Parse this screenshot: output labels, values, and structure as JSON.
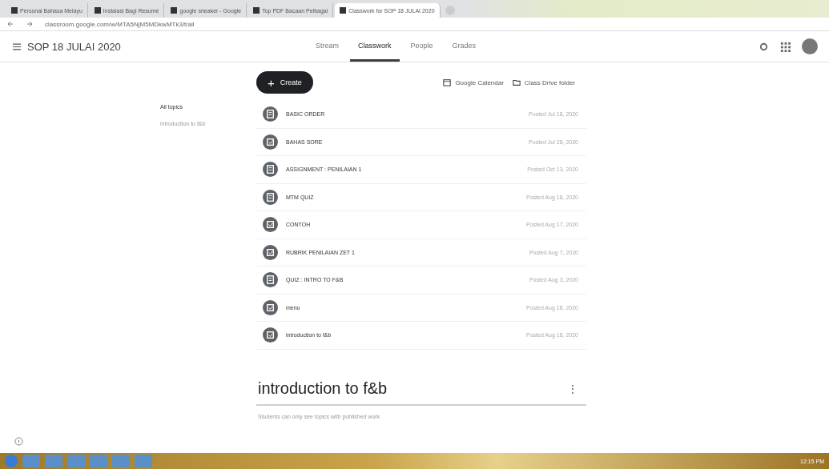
{
  "browser": {
    "tabs": [
      {
        "title": "Personal Bahasa Melayu",
        "selected": false
      },
      {
        "title": "Instalasi Bagi Resume",
        "selected": false
      },
      {
        "title": "google sneaker - Google",
        "selected": false
      },
      {
        "title": "Top PDF Bacaan Pelbagai",
        "selected": false
      },
      {
        "title": "Classwork for SOP 18 JULAI 2020",
        "selected": true
      }
    ],
    "url": "classroom.google.com/w/MTA5NjM5MDkwMTk3/t/all"
  },
  "header": {
    "title": "SOP 18 JULAI 2020",
    "tabs": [
      {
        "label": "Stream",
        "selected": false
      },
      {
        "label": "Classwork",
        "selected": true
      },
      {
        "label": "People",
        "selected": false
      },
      {
        "label": "Grades",
        "selected": false
      }
    ]
  },
  "toolbar": {
    "create_icon": "+",
    "create": "Create",
    "links": [
      "Google Calendar",
      "Class Drive folder"
    ]
  },
  "topics": [
    {
      "label": "All topics",
      "selected": true
    },
    {
      "label": "introduction to f&b",
      "selected": false
    }
  ],
  "items": [
    {
      "kind": "assignment",
      "title": "BASIC ORDER",
      "date": "Posted Jul 18, 2020"
    },
    {
      "kind": "quiz",
      "title": "BAHAS SORE",
      "date": "Posted Jul 28, 2020"
    },
    {
      "kind": "assignment",
      "title": "ASSIGNMENT : PENILAIAN 1",
      "date": "Posted Oct 13, 2020"
    },
    {
      "kind": "assignment",
      "title": "MTM QUIZ",
      "date": "Posted Aug 18, 2020"
    },
    {
      "kind": "quiz",
      "title": "CONTOH",
      "date": "Posted Aug 17, 2020"
    },
    {
      "kind": "quiz",
      "title": "RUBRIK PENILAIAN ZET 1",
      "date": "Posted Aug 7, 2020"
    },
    {
      "kind": "assignment",
      "title": "QUIZ : INTRO TO F&B",
      "date": "Posted Aug 3, 2020"
    },
    {
      "kind": "quiz",
      "title": "menu",
      "date": "Posted Aug 18, 2020"
    },
    {
      "kind": "quiz",
      "title": "introduction to f&b",
      "date": "Posted Aug 18, 2020"
    }
  ],
  "topic_section": {
    "title": "introduction to f&b",
    "menu": "⋮",
    "note": "Students can only see topics with published work"
  },
  "taskbar": {
    "clock": "12:15 PM"
  }
}
